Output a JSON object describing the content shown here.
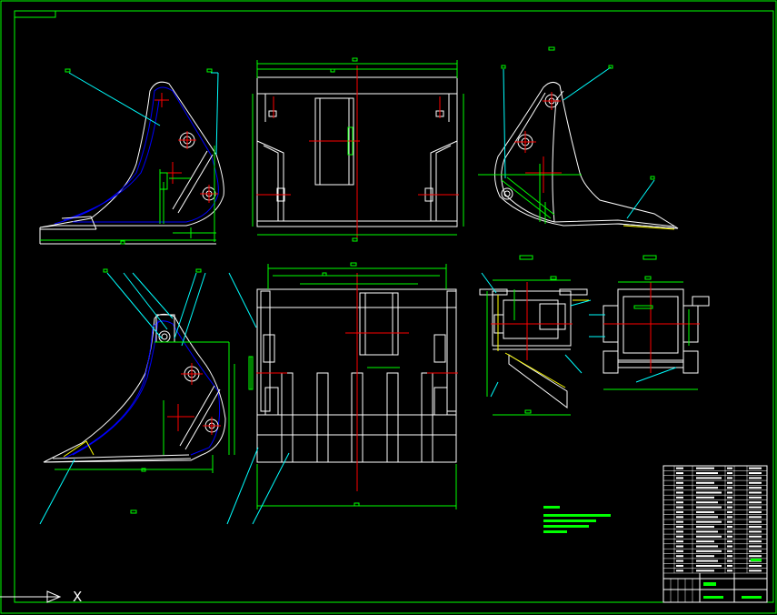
{
  "drawing": {
    "background": "#000000",
    "colors": {
      "frame": "#00ff00",
      "outline": "#ffffff",
      "inner": "#0000ff",
      "center": "#ff0000",
      "dimension": "#00ff00",
      "leader": "#00ffff",
      "hidden": "#ffff00",
      "note": "#00ff00"
    }
  },
  "ucs": {
    "axis_label": "X"
  },
  "title_block": {
    "rows": 22
  }
}
